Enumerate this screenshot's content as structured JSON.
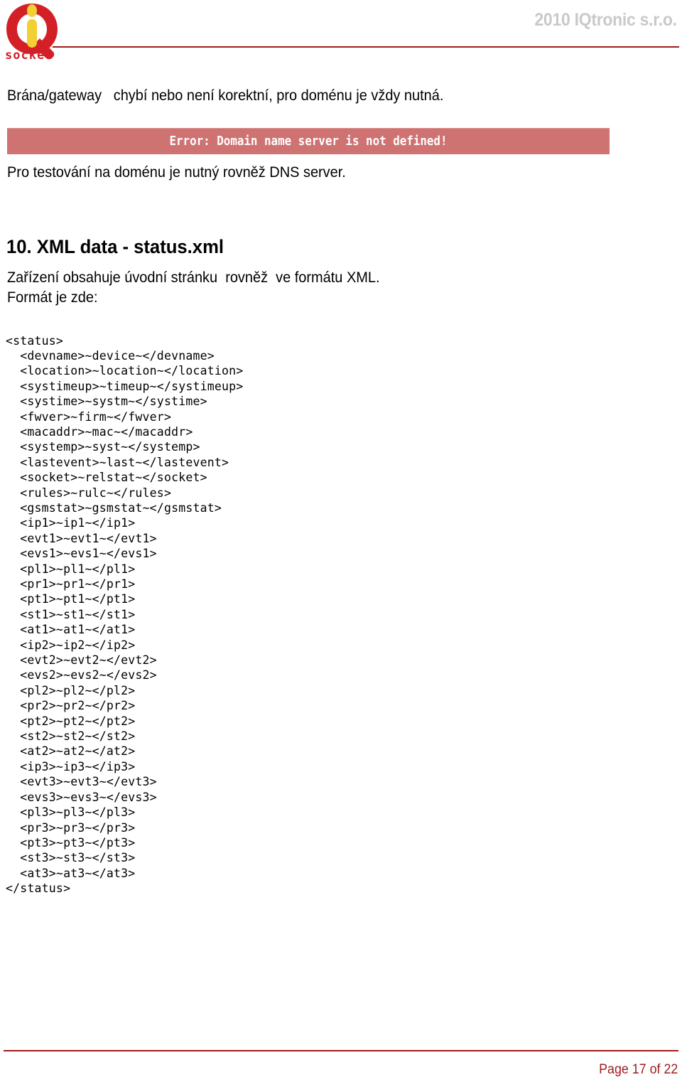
{
  "header": {
    "company": "2010 IQtronic  s.r.o.",
    "logo_alt": "IQ socket",
    "logo_word": "socket"
  },
  "body": {
    "para_1": "Brána/gateway   chybí nebo není korektní, pro doménu je vždy nutná.",
    "para_2": "Pro testování na doménu je nutný rovněž DNS server.",
    "error_banner": "Error: Domain name server is not defined!",
    "section_heading": "10. XML data - status.xml",
    "para_3": "Zařízení obsahuje úvodní stránku  rovněž  ve formátu XML.",
    "para_4": "Formát je zde:",
    "xml_code": "<status>\n  <devname>~device~</devname>\n  <location>~location~</location>\n  <systimeup>~timeup~</systimeup>\n  <systime>~systm~</systime>\n  <fwver>~firm~</fwver>\n  <macaddr>~mac~</macaddr>\n  <systemp>~syst~</systemp>\n  <lastevent>~last~</lastevent>\n  <socket>~relstat~</socket>\n  <rules>~rulc~</rules>\n  <gsmstat>~gsmstat~</gsmstat>\n  <ip1>~ip1~</ip1>\n  <evt1>~evt1~</evt1>\n  <evs1>~evs1~</evs1>\n  <pl1>~pl1~</pl1>\n  <pr1>~pr1~</pr1>\n  <pt1>~pt1~</pt1>\n  <st1>~st1~</st1>\n  <at1>~at1~</at1>\n  <ip2>~ip2~</ip2>\n  <evt2>~evt2~</evt2>\n  <evs2>~evs2~</evs2>\n  <pl2>~pl2~</pl2>\n  <pr2>~pr2~</pr2>\n  <pt2>~pt2~</pt2>\n  <st2>~st2~</st2>\n  <at2>~at2~</at2>\n  <ip3>~ip3~</ip3>\n  <evt3>~evt3~</evt3>\n  <evs3>~evs3~</evs3>\n  <pl3>~pl3~</pl3>\n  <pr3>~pr3~</pr3>\n  <pt3>~pt3~</pt3>\n  <st3>~st3~</st3>\n  <at3>~at3~</at3>\n</status>"
  },
  "footer": {
    "page_label": "Page 17 of 22"
  },
  "colors": {
    "rule_red": "#9E1B1B",
    "banner_bg": "#CF7272",
    "banner_text": "#FFFFFF",
    "company_gray": "#C9C9C9",
    "logo_red": "#D32027",
    "logo_yellow": "#F2CF33"
  }
}
